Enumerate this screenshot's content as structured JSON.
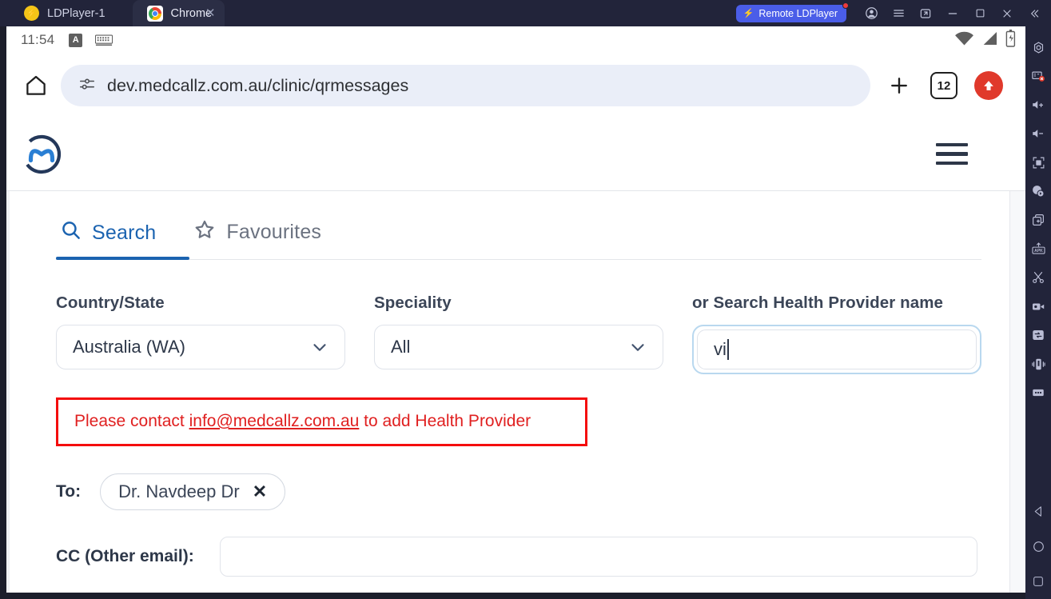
{
  "titlebar": {
    "tabs": [
      {
        "label": "LDPlayer-1",
        "icon": "ldplayer-icon",
        "active": false
      },
      {
        "label": "Chrome",
        "icon": "chrome-icon",
        "active": true
      }
    ],
    "remote_button": "Remote LDPlayer",
    "controls": [
      "account-icon",
      "menu-icon",
      "popout-icon",
      "minimize-icon",
      "maximize-icon",
      "close-icon",
      "collapse-icon"
    ]
  },
  "statusbar": {
    "time": "11:54",
    "ime_badge": "A",
    "icons": [
      "keyboard-icon",
      "wifi-icon",
      "signal-icon",
      "battery-charging-icon"
    ]
  },
  "browser": {
    "url": "dev.medcallz.com.au/clinic/qrmessages",
    "tab_count": "12",
    "buttons": [
      "home-icon",
      "page-info-icon",
      "new-tab-icon",
      "tab-switcher",
      "update-icon"
    ]
  },
  "page": {
    "brand": "MedCallz",
    "menu": "hamburger-menu",
    "tabs": [
      {
        "label": "Search",
        "icon": "search-icon",
        "active": true
      },
      {
        "label": "Favourites",
        "icon": "star-icon",
        "active": false
      }
    ],
    "fields": {
      "country": {
        "label": "Country/State",
        "value": "Australia (WA)"
      },
      "speciality": {
        "label": "Speciality",
        "value": "All"
      },
      "provider": {
        "label": "or Search Health Provider name",
        "value": "vi",
        "placeholder": ""
      }
    },
    "alert": {
      "prefix": "Please contact ",
      "email": "info@medcallz.com.au",
      "suffix": " to add Health Provider",
      "border_color": "#f40d0d",
      "text_color": "#e02020"
    },
    "to": {
      "label": "To:",
      "recipients": [
        {
          "name": "Dr. Navdeep Dr",
          "remove": "✕"
        }
      ]
    },
    "cc": {
      "label": "CC (Other email):",
      "value": "",
      "placeholder": ""
    }
  },
  "sidebar": {
    "items": [
      "settings-gear-icon",
      "adblock-icon",
      "volume-up-icon",
      "volume-down-icon",
      "fullscreen-icon",
      "location-icon",
      "multi-instance-icon",
      "apk-install-icon",
      "scissors-icon",
      "record-video-icon",
      "sync-icon",
      "shake-icon",
      "more-icon"
    ],
    "nav": [
      "back-icon",
      "home-icon",
      "recents-icon"
    ]
  },
  "colors": {
    "accent": "#1b63b0",
    "titlebar_bg": "#22243a",
    "remote_btn": "#4a5de8",
    "update_btn": "#e0392b",
    "alert": "#e02020"
  }
}
